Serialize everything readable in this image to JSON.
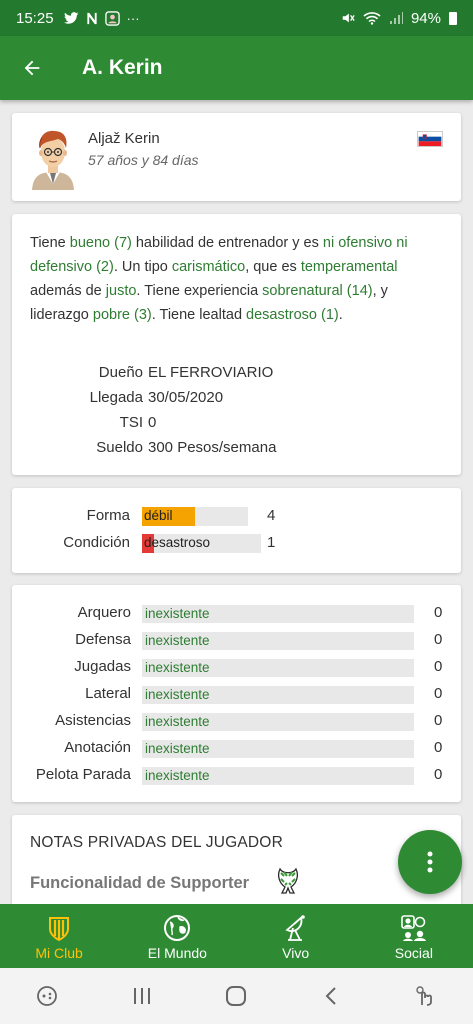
{
  "status_bar": {
    "time": "15:25",
    "battery": "94%"
  },
  "appbar": {
    "title": "A. Kerin"
  },
  "player": {
    "full_name": "Aljaž Kerin",
    "age": "57 años y 84 días"
  },
  "description": {
    "p1": "Tiene ",
    "coaching": "bueno (7)",
    "p2": " habilidad de entrenador y es ",
    "style": "ni ofensivo ni defensivo (2)",
    "p3": ". Un tipo ",
    "agreeability": "carismático",
    "p4": ", que es ",
    "aggressiveness": "temperamental",
    "p5": " además de ",
    "honesty": "justo",
    "p6": ". Tiene experiencia ",
    "experience": "sobrenatural (14)",
    "p7": ", y liderazgo ",
    "leadership": "pobre (3)",
    "p8": ". Tiene lealtad ",
    "loyalty": "desastroso (1)",
    "p9": "."
  },
  "info": [
    {
      "label": "Dueño",
      "value": "EL FERROVIARIO"
    },
    {
      "label": "Llegada",
      "value": "30/05/2020"
    },
    {
      "label": "TSI",
      "value": "0"
    },
    {
      "label": "Sueldo",
      "value": "300 Pesos/semana"
    }
  ],
  "condition": [
    {
      "label": "Forma",
      "bar_text": "débil",
      "value": "4",
      "level": 0.5,
      "color": "#f5a300"
    },
    {
      "label": "Condición",
      "bar_text": "desastroso",
      "value": "1",
      "level": 0.1,
      "color": "#e53935"
    }
  ],
  "skills": [
    {
      "label": "Arquero",
      "bar_text": "inexistente",
      "value": "0"
    },
    {
      "label": "Defensa",
      "bar_text": "inexistente",
      "value": "0"
    },
    {
      "label": "Jugadas",
      "bar_text": "inexistente",
      "value": "0"
    },
    {
      "label": "Lateral",
      "bar_text": "inexistente",
      "value": "0"
    },
    {
      "label": "Asistencias",
      "bar_text": "inexistente",
      "value": "0"
    },
    {
      "label": "Anotación",
      "bar_text": "inexistente",
      "value": "0"
    },
    {
      "label": "Pelota Parada",
      "bar_text": "inexistente",
      "value": "0"
    }
  ],
  "notes": {
    "title": "NOTAS PRIVADAS DEL JUGADOR",
    "supporter": "Funcionalidad de Supporter"
  },
  "bottom_nav": [
    {
      "label": "Mi Club",
      "icon": "shield-icon",
      "active": true
    },
    {
      "label": "El Mundo",
      "icon": "globe-icon",
      "active": false
    },
    {
      "label": "Vivo",
      "icon": "satellite-icon",
      "active": false
    },
    {
      "label": "Social",
      "icon": "people-icon",
      "active": false
    }
  ],
  "colors": {
    "primary": "#2e8b34",
    "status_bar": "#237a2e",
    "accent": "#ffc107",
    "link_green": "#2e7d32"
  }
}
